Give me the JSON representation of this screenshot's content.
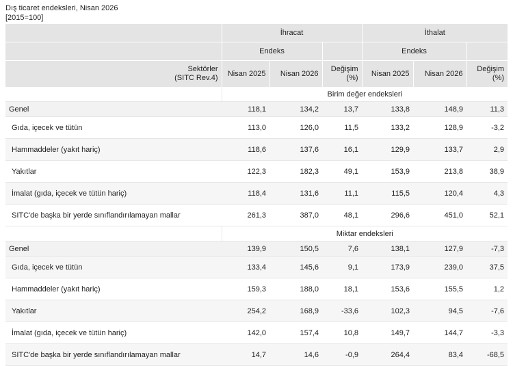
{
  "title": "Dış ticaret endeksleri, Nisan 2026",
  "base_note": "[2015=100]",
  "header": {
    "export_label": "İhracat",
    "import_label": "İthalat",
    "index_label": "Endeks",
    "sector_label_line1": "Sektörler",
    "sector_label_line2": "(SITC Rev.4)",
    "col_prev": "Nisan 2025",
    "col_curr": "Nisan 2026",
    "col_change_line1": "Değişim",
    "col_change_line2": "(%)"
  },
  "sections": [
    {
      "title": "Birim değer endeksleri",
      "rows": [
        {
          "name": "Genel",
          "vals": [
            "118,1",
            "134,2",
            "13,7",
            "133,8",
            "148,9",
            "11,3"
          ]
        },
        {
          "name": "Gıda, içecek ve tütün",
          "vals": [
            "113,0",
            "126,0",
            "11,5",
            "133,2",
            "128,9",
            "-3,2"
          ]
        },
        {
          "name": "Hammaddeler (yakıt hariç)",
          "vals": [
            "118,6",
            "137,6",
            "16,1",
            "129,9",
            "133,7",
            "2,9"
          ]
        },
        {
          "name": "Yakıtlar",
          "vals": [
            "122,3",
            "182,3",
            "49,1",
            "153,9",
            "213,8",
            "38,9"
          ]
        },
        {
          "name": "İmalat (gıda, içecek ve tütün hariç)",
          "vals": [
            "118,4",
            "131,6",
            "11,1",
            "115,5",
            "120,4",
            "4,3"
          ]
        },
        {
          "name": "SITC'de başka bir yerde sınıflandırılamayan mallar",
          "vals": [
            "261,3",
            "387,0",
            "48,1",
            "296,6",
            "451,0",
            "52,1"
          ]
        }
      ]
    },
    {
      "title": "Miktar endeksleri",
      "rows": [
        {
          "name": "Genel",
          "vals": [
            "139,9",
            "150,5",
            "7,6",
            "138,1",
            "127,9",
            "-7,3"
          ]
        },
        {
          "name": "Gıda, içecek ve tütün",
          "vals": [
            "133,4",
            "145,6",
            "9,1",
            "173,9",
            "239,0",
            "37,5"
          ]
        },
        {
          "name": "Hammaddeler (yakıt hariç)",
          "vals": [
            "159,3",
            "188,0",
            "18,1",
            "153,6",
            "155,5",
            "1,2"
          ]
        },
        {
          "name": "Yakıtlar",
          "vals": [
            "254,2",
            "168,9",
            "-33,6",
            "102,3",
            "94,5",
            "-7,6"
          ]
        },
        {
          "name": "İmalat (gıda, içecek ve tütün hariç)",
          "vals": [
            "142,0",
            "157,4",
            "10,8",
            "149,7",
            "144,7",
            "-3,3"
          ]
        },
        {
          "name": "SITC'de başka bir yerde sınıflandırılamayan mallar",
          "vals": [
            "14,7",
            "14,6",
            "-0,9",
            "264,4",
            "83,4",
            "-68,5"
          ]
        }
      ]
    }
  ]
}
